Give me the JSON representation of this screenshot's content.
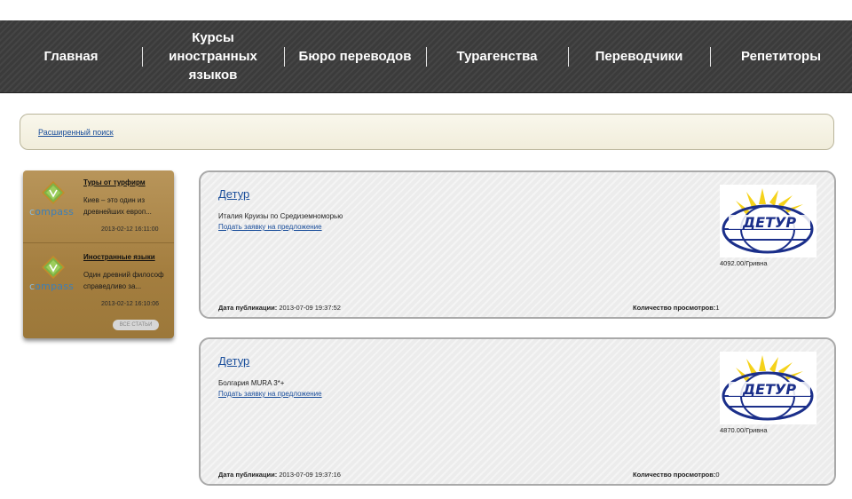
{
  "nav": {
    "items": [
      {
        "label": "Главная"
      },
      {
        "label": "Курсы иностранных языков"
      },
      {
        "label": "Бюро переводов"
      },
      {
        "label": "Турагенства"
      },
      {
        "label": "Переводчики"
      },
      {
        "label": "Репетиторы"
      }
    ]
  },
  "search": {
    "advanced_link": "Расширенный поиск"
  },
  "sidebar": {
    "logo_text": "compass",
    "articles": [
      {
        "title": "Туры от турфирм",
        "excerpt": "Киев – это один из древнейших европ...",
        "date": "2013-02-12 16:11:00"
      },
      {
        "title": "Иностранные языки",
        "excerpt": "Один древний философ справедливо за...",
        "date": "2013-02-12 16:10:06"
      }
    ],
    "all_articles_label": "ВСЕ СТАТЬИ"
  },
  "offers": [
    {
      "title": "Детур",
      "description": "Италия Круизы по Средиземноморью",
      "request_link": "Подать заявку на предложение",
      "price": "4092.00/Гривна",
      "date_label": "Дата публикации:",
      "date": "2013-07-09 19:37:52",
      "views_label": "Количество просмотров:",
      "views": "1",
      "logo_text": "ДЕТУР"
    },
    {
      "title": "Детур",
      "description": "Болгария MURA 3*+",
      "request_link": "Подать заявку на предложение",
      "price": "4870.00/Гривна",
      "date_label": "Дата публикации:",
      "date": "2013-07-09 19:37:16",
      "views_label": "Количество просмотров:",
      "views": "0",
      "logo_text": "ДЕТУР"
    }
  ],
  "colors": {
    "nav_bg": "#3b3b3b",
    "link": "#1a4e9b",
    "sidebar_bg": "#a98546",
    "logo_blue": "#1b2f8a",
    "logo_yellow": "#f5d21a"
  }
}
